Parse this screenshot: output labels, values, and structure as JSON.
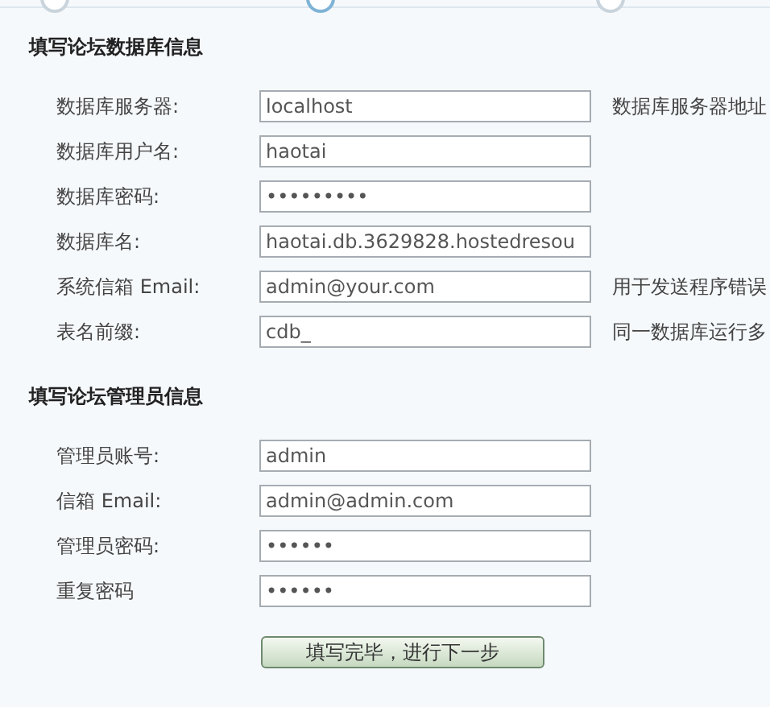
{
  "steps": [
    {
      "active": false
    },
    {
      "active": true
    },
    {
      "active": false
    }
  ],
  "sections": [
    {
      "title": "填写论坛数据库信息",
      "fields": [
        {
          "label": "数据库服务器:",
          "value": "localhost",
          "hint": "数据库服务器地址"
        },
        {
          "label": "数据库用户名:",
          "value": "haotai"
        },
        {
          "label": "数据库密码:",
          "value": "•••••••••"
        },
        {
          "label": "数据库名:",
          "value": "haotai.db.3629828.hostedresou"
        },
        {
          "label": "系统信箱  Email:",
          "value": "admin@your.com",
          "hint": "用于发送程序错误"
        },
        {
          "label": "表名前缀:",
          "value": "cdb_",
          "hint": "同一数据库运行多"
        }
      ]
    },
    {
      "title": "填写论坛管理员信息",
      "fields": [
        {
          "label": "管理员账号:",
          "value": "admin"
        },
        {
          "label": "信箱  Email:",
          "value": "admin@admin.com"
        },
        {
          "label": "管理员密码:",
          "value": "••••••"
        },
        {
          "label": "重复密码",
          "value": "••••••"
        }
      ]
    }
  ],
  "submit": "填写完毕，进行下一步"
}
